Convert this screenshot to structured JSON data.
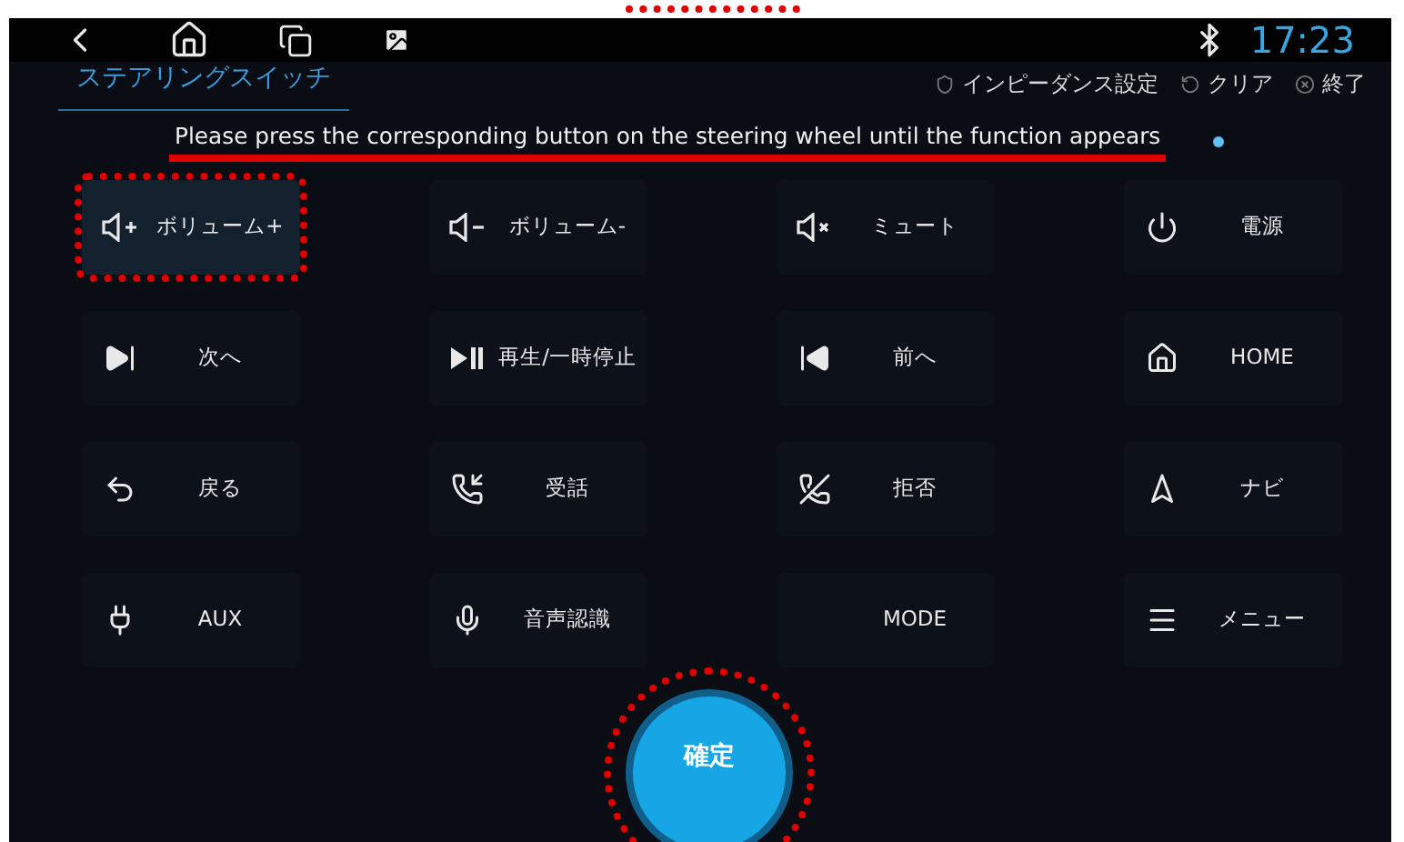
{
  "top_annotation_mark": true,
  "status_bar": {
    "time": "17:23"
  },
  "tab": {
    "label": "ステアリングスイッチ",
    "selected": true
  },
  "actions": [
    {
      "kind": "impedance",
      "label": "インピーダンス設定"
    },
    {
      "kind": "clear",
      "label": "クリア"
    },
    {
      "kind": "exit",
      "label": "終了"
    }
  ],
  "instruction": {
    "text": "Please press the corresponding button on the steering wheel until the function appears",
    "underlined": true
  },
  "functions": [
    {
      "kind": "volume-up",
      "label": "ボリューム+",
      "highlighted": true
    },
    {
      "kind": "volume-down",
      "label": "ボリューム-",
      "highlighted": false
    },
    {
      "kind": "mute",
      "label": "ミュート",
      "highlighted": false
    },
    {
      "kind": "power",
      "label": "電源",
      "highlighted": false
    },
    {
      "kind": "next",
      "label": "次へ",
      "highlighted": false
    },
    {
      "kind": "play-pause",
      "label": "再生/一時停止",
      "highlighted": false
    },
    {
      "kind": "previous",
      "label": "前へ",
      "highlighted": false
    },
    {
      "kind": "home",
      "label": "HOME",
      "highlighted": false
    },
    {
      "kind": "back",
      "label": "戻る",
      "highlighted": false
    },
    {
      "kind": "answer",
      "label": "受話",
      "highlighted": false
    },
    {
      "kind": "reject",
      "label": "拒否",
      "highlighted": false
    },
    {
      "kind": "navi",
      "label": "ナビ",
      "highlighted": false
    },
    {
      "kind": "aux",
      "label": "AUX",
      "highlighted": false
    },
    {
      "kind": "voice",
      "label": "音声認識",
      "highlighted": false
    },
    {
      "kind": "mode",
      "label": "MODE",
      "highlighted": false
    },
    {
      "kind": "menu",
      "label": "メニュー",
      "highlighted": false
    }
  ],
  "confirm_button": {
    "label": "確定",
    "highlighted": true
  }
}
